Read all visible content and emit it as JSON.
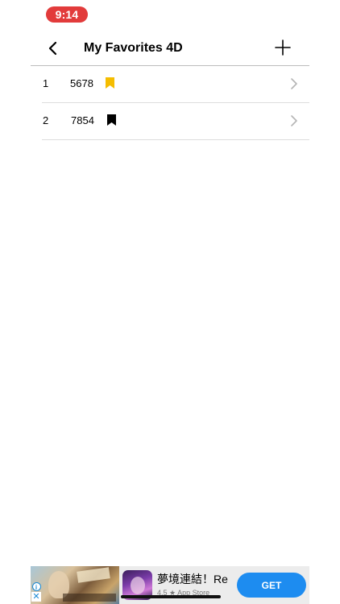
{
  "status_bar": {
    "time": "9:14",
    "time_pill_color": "#e23b3b"
  },
  "nav": {
    "title": "My Favorites 4D",
    "back_icon": "chevron-left-icon",
    "add_icon": "plus-icon"
  },
  "favorites": [
    {
      "index": "1",
      "number": "5678",
      "bookmark_color": "#f5bd00",
      "bookmark_icon": "bookmark-icon"
    },
    {
      "index": "2",
      "number": "7854",
      "bookmark_color": "#000000",
      "bookmark_icon": "bookmark-icon"
    }
  ],
  "ad": {
    "app_title": "夢境連結！Re",
    "app_subtitle": "4.5 ★ App Store",
    "get_label": "GET",
    "get_color": "#1d8cf0",
    "info_label": "i",
    "close_label": "✕"
  }
}
